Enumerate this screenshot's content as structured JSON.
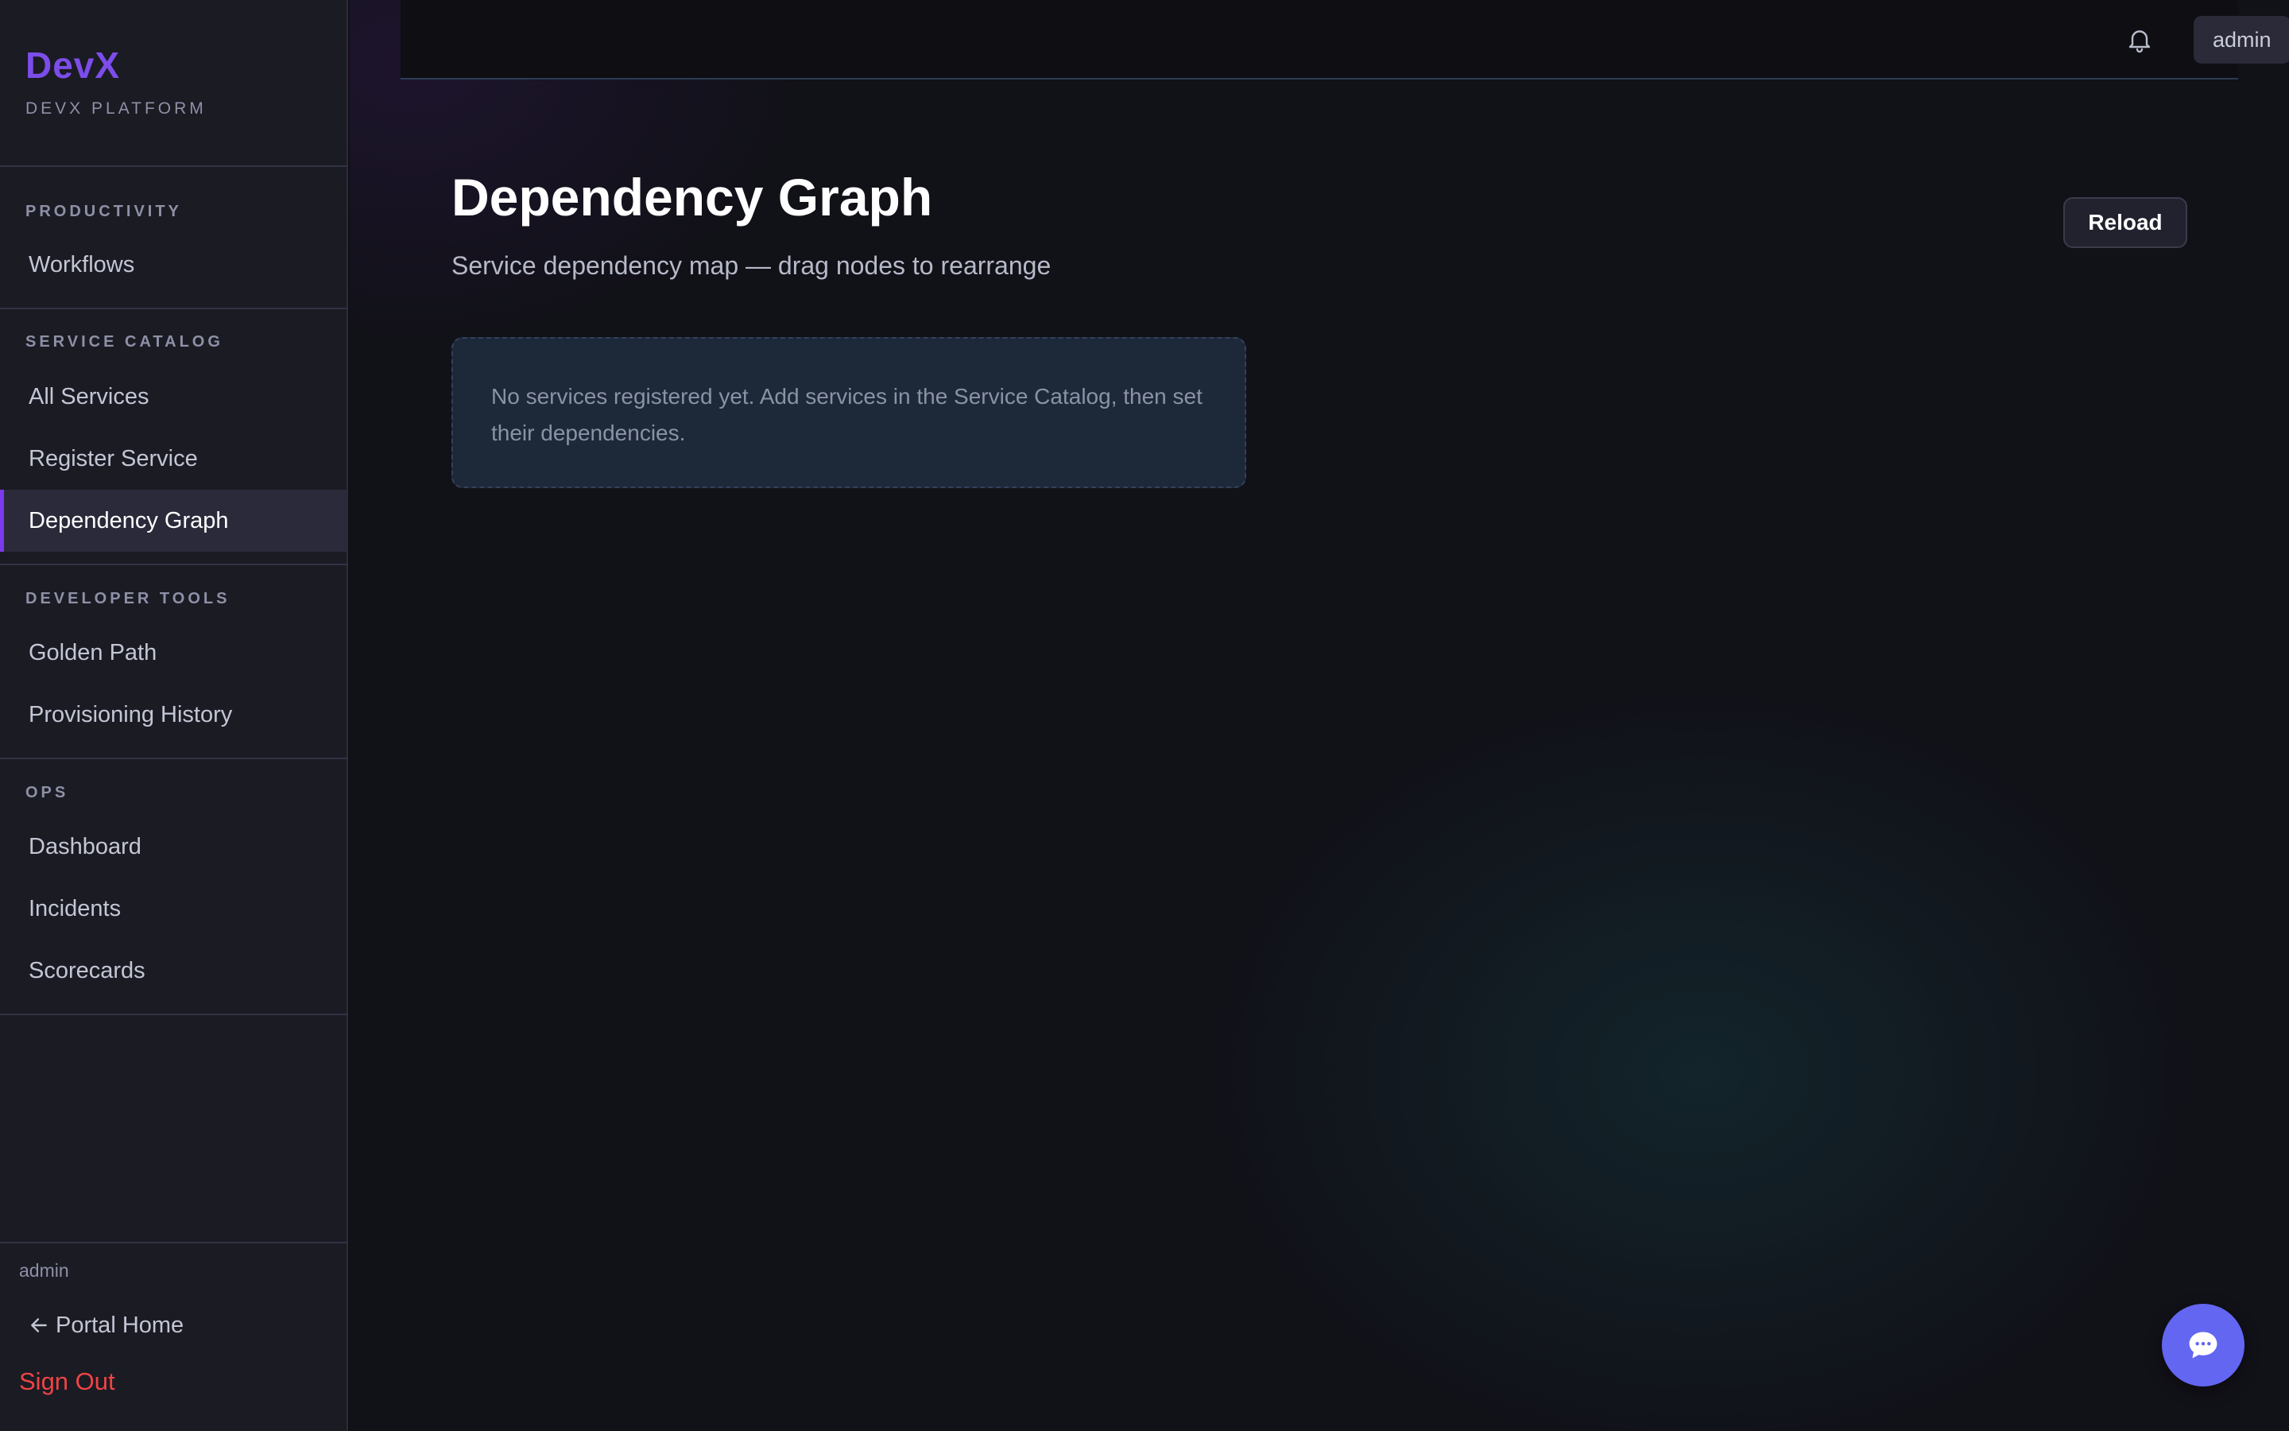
{
  "brand": {
    "name": "DevX",
    "subtitle": "DEVX PLATFORM"
  },
  "sidebar": {
    "sections": [
      {
        "title": "PRODUCTIVITY",
        "items": [
          {
            "label": "Workflows"
          }
        ]
      },
      {
        "title": "SERVICE CATALOG",
        "items": [
          {
            "label": "All Services"
          },
          {
            "label": "Register Service"
          },
          {
            "label": "Dependency Graph",
            "active": true
          }
        ]
      },
      {
        "title": "DEVELOPER TOOLS",
        "items": [
          {
            "label": "Golden Path"
          },
          {
            "label": "Provisioning History"
          }
        ]
      },
      {
        "title": "OPS",
        "items": [
          {
            "label": "Dashboard"
          },
          {
            "label": "Incidents"
          },
          {
            "label": "Scorecards"
          }
        ]
      }
    ],
    "user": "admin",
    "portal_home": "Portal Home",
    "sign_out": "Sign Out"
  },
  "topbar": {
    "user": "admin",
    "bell_icon": "bell-icon"
  },
  "main": {
    "title": "Dependency Graph",
    "subtitle": "Service dependency map — drag nodes to rearrange",
    "reload_label": "Reload",
    "empty_message": "No services registered yet. Add services in the Service Catalog, then set their dependencies."
  },
  "chat": {
    "icon": "chat-bubble-icon"
  },
  "colors": {
    "accent": "#7c3aed",
    "brand": "#7c4dea",
    "danger": "#ef4444",
    "fab": "#6366f1"
  }
}
